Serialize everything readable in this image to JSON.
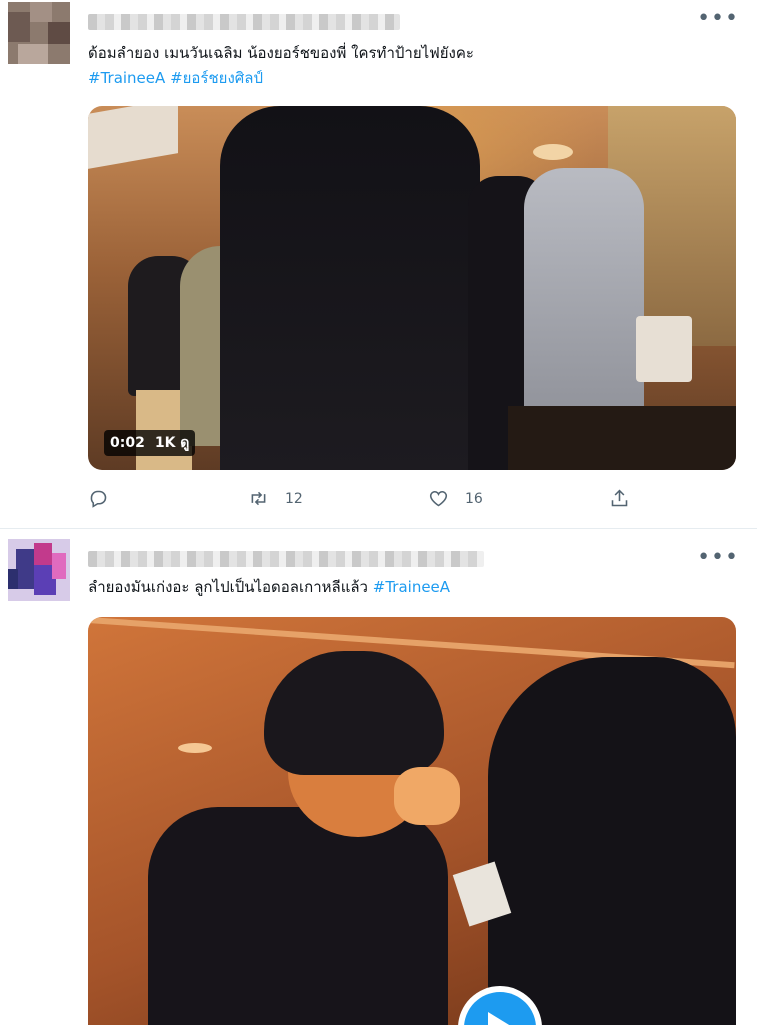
{
  "tweets": [
    {
      "text": "ด้อมลำยอง เมนวันเฉลิม น้องยอร์ชของพี่ ใครทำป้ายไฟยังคะ",
      "hashtags": [
        "#TraineeA",
        "#ยอร์ชยงศิลป์"
      ],
      "media": {
        "duration": "0:02",
        "views": "1K ดู"
      },
      "actions": {
        "reply": "",
        "retweet": "12",
        "like": "16",
        "share": ""
      },
      "icons": {
        "reply": "reply-icon",
        "retweet": "retweet-icon",
        "like": "heart-icon",
        "share": "share-icon",
        "more": "more-icon"
      }
    },
    {
      "text": "ลำยองมันเก่งอะ ลูกไปเป็นไอดอลเกาหลีแล้ว",
      "hashtags": [
        "#TraineeA"
      ],
      "icons": {
        "play": "play-icon",
        "more": "more-icon"
      }
    }
  ],
  "colors": {
    "accent": "#1d9bf0",
    "muted": "#536471",
    "border": "#e6ecf0"
  }
}
